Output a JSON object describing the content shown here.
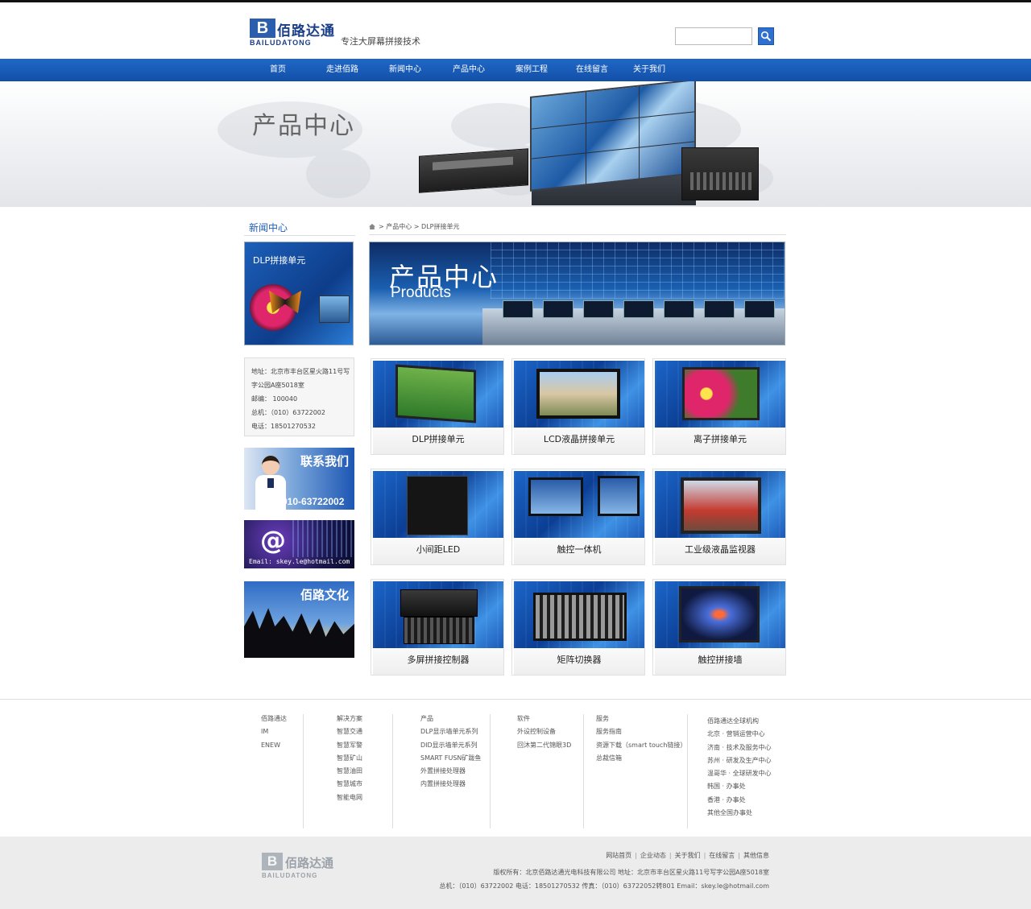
{
  "header": {
    "logo_cn": "佰路达通",
    "logo_en": "BAILUDATONG",
    "logo_mark": "B",
    "slogan": "专注大屏幕拼接技术",
    "search_placeholder": "",
    "search_icon": "magnifier"
  },
  "nav": [
    {
      "label": "首页"
    },
    {
      "label": "走进佰路"
    },
    {
      "label": "新闻中心"
    },
    {
      "label": "产品中心"
    },
    {
      "label": "案例工程"
    },
    {
      "label": "在线留言"
    },
    {
      "label": "关于我们"
    }
  ],
  "banner": {
    "title": "产品中心"
  },
  "sidebar": {
    "title": "新闻中心",
    "promo_label": "DLP拼接单元",
    "contact": {
      "address": "地址：北京市丰台区星火路11号写",
      "address_cont": "字公园A座5018室",
      "postcode": "邮编：  100040",
      "phone": "总机：（010）63722002",
      "mobile": "电话：18501270532"
    },
    "contact_banner": {
      "title": "联系我们",
      "phone": "010-63722002"
    },
    "email_banner": {
      "at": "@",
      "text": "Email: skey.le@hotmail.com"
    },
    "culture_banner": {
      "title": "佰路文化"
    }
  },
  "breadcrumb": {
    "text": "> 产品中心 > DLP拼接单元"
  },
  "main_banner": {
    "title": "产品中心",
    "subtitle": "Products"
  },
  "products": [
    {
      "label": "DLP拼接单元"
    },
    {
      "label": "LCD液晶拼接单元"
    },
    {
      "label": "离子拼接单元"
    },
    {
      "label": "小间距LED"
    },
    {
      "label": "触控一体机"
    },
    {
      "label": "工业级液晶监视器"
    },
    {
      "label": "多屏拼接控制器"
    },
    {
      "label": "矩阵切换器"
    },
    {
      "label": "触控拼接墙"
    }
  ],
  "footer_columns": [
    {
      "items": [
        "佰路通达",
        "IM",
        "ENEW"
      ]
    },
    {
      "items": [
        "解决方案",
        "智慧交通",
        "智慧军警",
        "智慧矿山",
        "智慧油田",
        "智慧城市",
        "智能电网"
      ]
    },
    {
      "items": [
        "产品",
        "DLP显示墙单元系列",
        "DID显示墙单元系列",
        "SMART FUSN矿跋鱼",
        "外置拼接处理器",
        "内置拼接处理器"
      ]
    },
    {
      "items": [
        "软件",
        "外设控制设备",
        "回沐第二代锦眼3D"
      ]
    },
    {
      "items": [
        "服务",
        "服务指南",
        "资源下载（smart touch链接）",
        "总裁信箱"
      ]
    },
    {
      "items": [
        "佰路通达全球机构",
        "北京 · 营销运营中心",
        "济南 · 技术及服务中心",
        "苏州 · 研发及生产中心",
        "温哥华 · 全球研发中心",
        "韩国 · 办事处",
        "香港 · 办事处",
        "其他全国办事处"
      ]
    }
  ],
  "footer": {
    "logo_cn": "佰路达通",
    "logo_en": "BAILUDATONG",
    "logo_mark": "B",
    "nav": [
      "网站首页",
      "企业动态",
      "关于我们",
      "在线留言",
      "其他信息"
    ],
    "copyright": "版权所有：北京佰路达通光电科技有限公司    地址：北京市丰台区星火路11号写字公园A座5018室",
    "contact": "总机：（010）63722002    电话：18501270532    传真：（010）63722052转801    Email：skey.le@hotmail.com"
  }
}
